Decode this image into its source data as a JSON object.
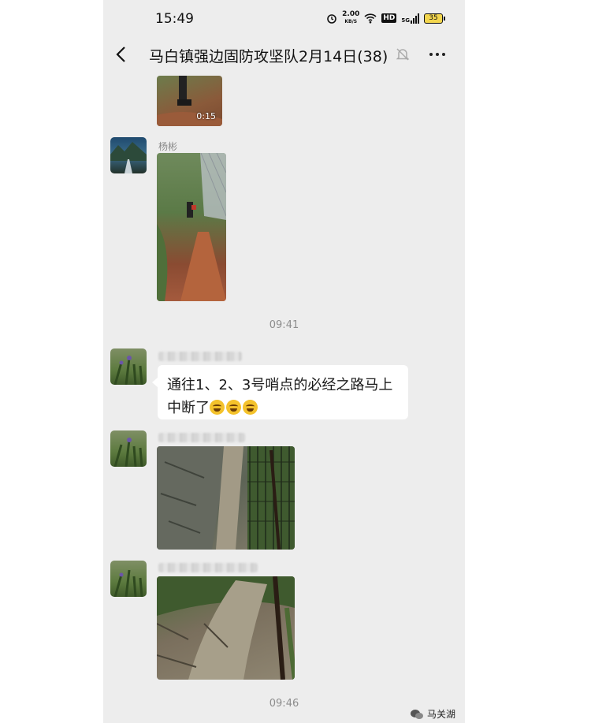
{
  "status_bar": {
    "time": "15:49",
    "net_speed": "2.00",
    "net_unit": "KB/S",
    "hd": "HD",
    "signal": "5G",
    "battery": "35"
  },
  "header": {
    "title": "马白镇强边固防攻坚队2月14日(38)"
  },
  "messages": {
    "video_duration": "0:15",
    "sender_1": "杨彬",
    "timestamp_1": "09:41",
    "text_message": "通往1、2、3号哨点的必经之路马上中断了",
    "timestamp_2": "09:46"
  },
  "watermark": {
    "text": "马关湖"
  }
}
